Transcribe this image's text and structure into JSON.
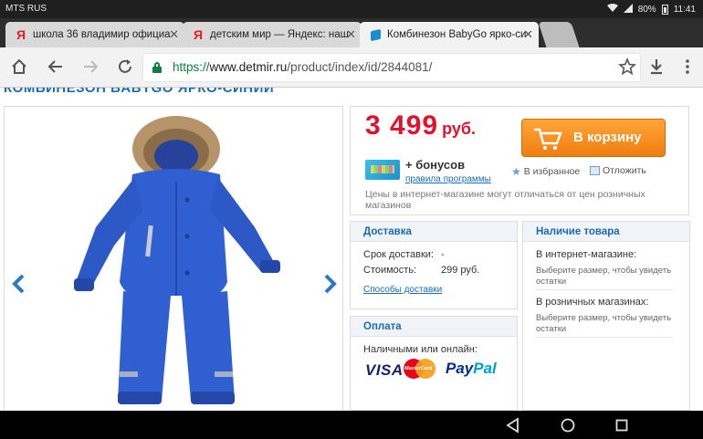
{
  "status_bar": {
    "carrier": "MTS RUS",
    "battery": "80%",
    "time": "11:41"
  },
  "tabs": [
    {
      "title": "школа 36 владимир официа",
      "favicon": "yandex-icon"
    },
    {
      "title": "детским мир — Яндекс: наш",
      "favicon": "yandex-icon"
    },
    {
      "title": "Комбинезон BabyGo ярко-си",
      "favicon": "detmir-icon",
      "active": true
    }
  ],
  "address_bar": {
    "scheme": "https://",
    "host": "www.detmir.ru",
    "path": "/product/index/id/2844081/"
  },
  "product": {
    "title": "КОМБИНЕЗОН BABYGO ЯРКО-СИНИЙ",
    "image_color": "#2f5fd0",
    "price": "3 499",
    "currency": "руб.",
    "cart_button": "В корзину",
    "bonus_text": "+ бонусов",
    "bonus_link": "правила программы",
    "favorite": "В избранное",
    "defer": "Отложить",
    "price_note": "Цены в интернет-магазине могут отличаться от цен розничных магазинов"
  },
  "delivery": {
    "header": "Доставка",
    "term_label": "Срок доставки:",
    "term_value": "-",
    "cost_label": "Стоимость:",
    "cost_value": "299 руб.",
    "link": "Способы доставки"
  },
  "availability": {
    "header": "Наличие товара",
    "online_label": "В интернет-магазине:",
    "online_note": "Выберите размер, чтобы увидеть остатки",
    "retail_label": "В розничных магазинах:",
    "retail_note": "Выберите размер, чтобы увидеть остатки"
  },
  "payment": {
    "header": "Оплата",
    "subtitle": "Наличными или онлайн:",
    "visa": "VISA",
    "mastercard": "MasterCard",
    "paypal_a": "Pay",
    "paypal_b": "Pal"
  },
  "colors": {
    "accent": "#1a6cb3",
    "price": "#e1132c",
    "cart": "#f39019"
  }
}
